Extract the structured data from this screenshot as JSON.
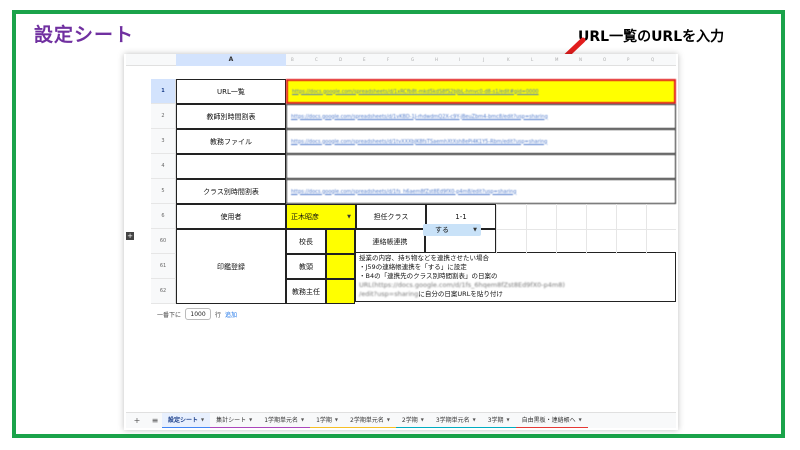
{
  "slide": {
    "title": "設定シート",
    "callout": "URL一覧のURLを入力",
    "accent_color": "#1aa34a",
    "title_color": "#7030a0",
    "arrow_color": "#e21d1d"
  },
  "sheet": {
    "column_a": "A",
    "mini_columns": [
      "B",
      "C",
      "D",
      "E",
      "F",
      "G",
      "H",
      "I",
      "J",
      "K",
      "L",
      "M",
      "N",
      "O",
      "P",
      "Q"
    ],
    "rows": [
      {
        "num": "1",
        "label": "URL一覧",
        "url": "https://docs.google.com/spreadsheets/d/1xRCfb8t-mkd5kdS8fS2bJbL-hmvc0-d8-s1/edit#gid=0000",
        "highlight": true
      },
      {
        "num": "2",
        "label": "教師別時間割表",
        "url": "https://docs.google.com/spreadsheets/d/1vKBD-1J-rhdwdmQ2X-c9Y-jBeuZbm4-bmc8/edit?usp=sharing"
      },
      {
        "num": "3",
        "label": "教務ファイル",
        "url": "https://docs.google.com/spreadsheets/d/1tvXXXbJK8fsTSaemhXtXsh8ePi4K1Y5-Rbm/edit?usp=sharing"
      },
      {
        "num": "4",
        "label": "",
        "url": ""
      },
      {
        "num": "5",
        "label": "クラス別時間割表",
        "url": "https://docs.google.com/spreadsheets/d/1fs_h6aem8fZst8Ed9fX0-p4m8/edit?usp=sharing"
      }
    ],
    "row6": {
      "num": "6",
      "label": "使用者",
      "user": "正木昭彦",
      "class_label": "担任クラス",
      "class_value": "1-1"
    },
    "row60": {
      "num": "60",
      "role": "校長",
      "contact_label": "連絡帳連携",
      "contact_value": "する"
    },
    "row61": {
      "num": "61",
      "role": "教頭"
    },
    "row62": {
      "num": "62",
      "role": "教務主任"
    },
    "seal_label": "印鑑登録",
    "notes": {
      "line1": "授業の内容、持ち物などを連携させたい場合",
      "line2": "・J59の連絡帳連携を「する」に設定",
      "line3": "・B4の「連携先のクラス別時間割表」の日案の",
      "line4_blur": "URL(https://docs.google.com/d/1fs_6hqem8fZst8Ed9fX0-p4m8)",
      "line5_blur": "/edit?usp=sharing",
      "line5": "に自分の日案URLを貼り付け"
    },
    "add_rows": {
      "prefix": "一番下に",
      "count": "1000",
      "unit": "行",
      "link": "追加"
    }
  },
  "tabs": {
    "add": "+",
    "menu": "≡",
    "items": [
      {
        "label": "設定シート",
        "active": true,
        "color": "#4285f4"
      },
      {
        "label": "集計シート",
        "color": "#ab47bc"
      },
      {
        "label": "1学期単元名",
        "color": "#ab47bc"
      },
      {
        "label": "1学期",
        "color": "#f6bf26"
      },
      {
        "label": "2学期単元名",
        "color": "#f6bf26"
      },
      {
        "label": "2学期",
        "color": "#00acc1"
      },
      {
        "label": "3学期単元名",
        "color": "#00acc1"
      },
      {
        "label": "3学期",
        "color": "#00acc1"
      },
      {
        "label": "自由黒板・連絡帳へ",
        "color": "#e53935"
      }
    ]
  }
}
